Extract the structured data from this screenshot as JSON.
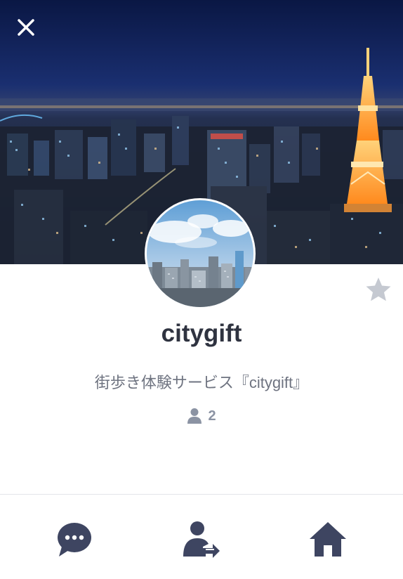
{
  "profile": {
    "name": "citygift",
    "description": "街歩き体験サービス『citygift』",
    "member_count": "2"
  },
  "icons": {
    "close": "close-icon",
    "favorite": "star-icon",
    "members": "person-icon",
    "chat": "chat-bubble-icon",
    "share": "person-share-icon",
    "home": "home-icon"
  },
  "colors": {
    "title": "#2f3340",
    "description": "#6e7380",
    "nav_icon": "#3e4561",
    "star": "#c5c9d1"
  }
}
